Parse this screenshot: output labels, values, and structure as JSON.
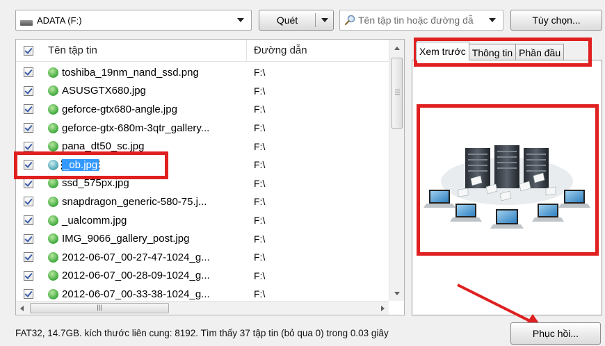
{
  "toolbar": {
    "drive_label": "ADATA (F:)",
    "scan_label": "Quét",
    "search_placeholder": "Tên tập tin hoặc đường dẫ",
    "options_label": "Tùy chọn..."
  },
  "file_list": {
    "columns": [
      "Tên tập tin",
      "Đường dẫn"
    ],
    "rows": [
      {
        "name": "toshiba_19nm_nand_ssd.png",
        "path": "F:\\",
        "checked": true
      },
      {
        "name": "ASUSGTX680.jpg",
        "path": "F:\\",
        "checked": true
      },
      {
        "name": "geforce-gtx680-angle.jpg",
        "path": "F:\\",
        "checked": true
      },
      {
        "name": "geforce-gtx-680m-3qtr_gallery...",
        "path": "F:\\",
        "checked": true
      },
      {
        "name": "pana_dt50_sc.jpg",
        "path": "F:\\",
        "checked": true
      },
      {
        "name": "_ob.jpg",
        "path": "F:\\",
        "checked": true,
        "selected": true
      },
      {
        "name": "ssd_575px.jpg",
        "path": "F:\\",
        "checked": true
      },
      {
        "name": "snapdragon_generic-580-75.j...",
        "path": "F:\\",
        "checked": true
      },
      {
        "name": "_ualcomm.jpg",
        "path": "F:\\",
        "checked": true
      },
      {
        "name": "IMG_9066_gallery_post.jpg",
        "path": "F:\\",
        "checked": true
      },
      {
        "name": "2012-06-07_00-27-47-1024_g...",
        "path": "F:\\",
        "checked": true
      },
      {
        "name": "2012-06-07_00-28-09-1024_g...",
        "path": "F:\\",
        "checked": true
      },
      {
        "name": "2012-06-07_00-33-38-1024_g...",
        "path": "F:\\",
        "checked": true
      }
    ]
  },
  "preview_panel": {
    "tabs": [
      "Xem trước",
      "Thông tin",
      "Phần đầu"
    ],
    "active_tab": "Xem trước"
  },
  "status": {
    "text": "FAT32, 14.7GB. kích thước liên cung: 8192. Tìm thấy 37 tập tin (bỏ qua 0) trong 0.03 giây"
  },
  "actions": {
    "restore_label": "Phục hồi..."
  },
  "colors": {
    "highlight": "#e02020",
    "selection": "#3399ff",
    "status_dot": "#3ea83c"
  }
}
